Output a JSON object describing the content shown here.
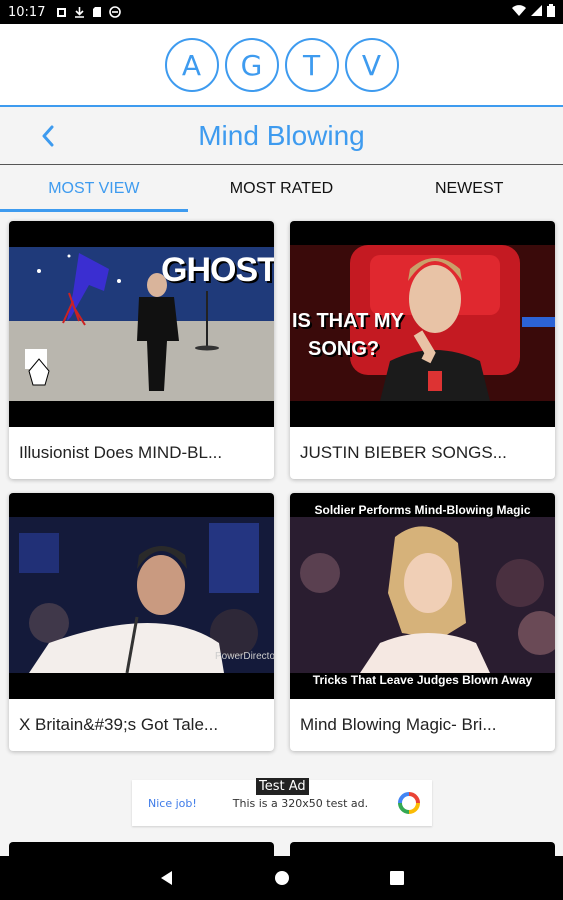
{
  "status_bar": {
    "time": "10:17"
  },
  "logo": {
    "letters": [
      "A",
      "G",
      "T",
      "V"
    ]
  },
  "header": {
    "title": "Mind Blowing"
  },
  "tabs": [
    {
      "label": "MOST VIEW",
      "active": true
    },
    {
      "label": "MOST RATED",
      "active": false
    },
    {
      "label": "NEWEST",
      "active": false
    }
  ],
  "videos": [
    {
      "title": "Illusionist Does MIND-BL...",
      "thumb_caption": "GHOST?"
    },
    {
      "title": "JUSTIN BIEBER SONGS...",
      "thumb_caption_lines": [
        "IS THAT MY",
        "SONG?"
      ]
    },
    {
      "title": "X Britain&#39;s Got Tale...",
      "thumb_watermark": "PowerDirector"
    },
    {
      "title": "Mind Blowing Magic- Bri...",
      "thumb_caption_top": "Soldier Performs Mind-Blowing Magic",
      "thumb_caption_bottom": "Tricks That Leave Judges Blown Away"
    }
  ],
  "ad": {
    "label": "Test Ad",
    "nice": "Nice job!",
    "text": "This is a 320x50 test ad."
  },
  "colors": {
    "accent": "#3e9bef",
    "background": "#f4f4f4"
  }
}
